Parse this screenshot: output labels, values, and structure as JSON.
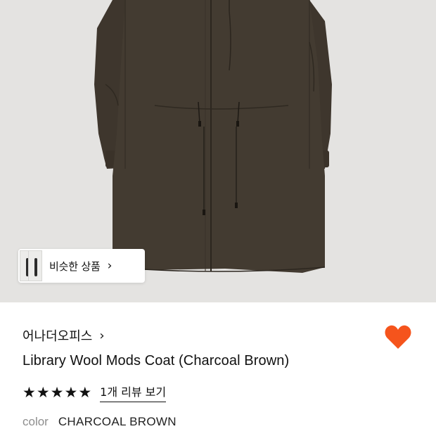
{
  "similar_products": {
    "label": "비슷한 상품",
    "chevron": "›"
  },
  "product": {
    "brand": "어나더오피스",
    "brand_chevron": "›",
    "name": "Library Wool Mods Coat (Charcoal Brown)",
    "rating_stars": 5,
    "star_glyph": "★",
    "review_link": "1개 리뷰 보기",
    "color_label": "color",
    "color_value": "CHARCOAL BROWN"
  },
  "icons": {
    "wishlist": "heart-icon",
    "similar": "chevron-right-icon",
    "brand": "chevron-right-icon"
  },
  "colors": {
    "heart": "#f5541c",
    "coat": "#433b31",
    "background": "#e4e3e1"
  }
}
